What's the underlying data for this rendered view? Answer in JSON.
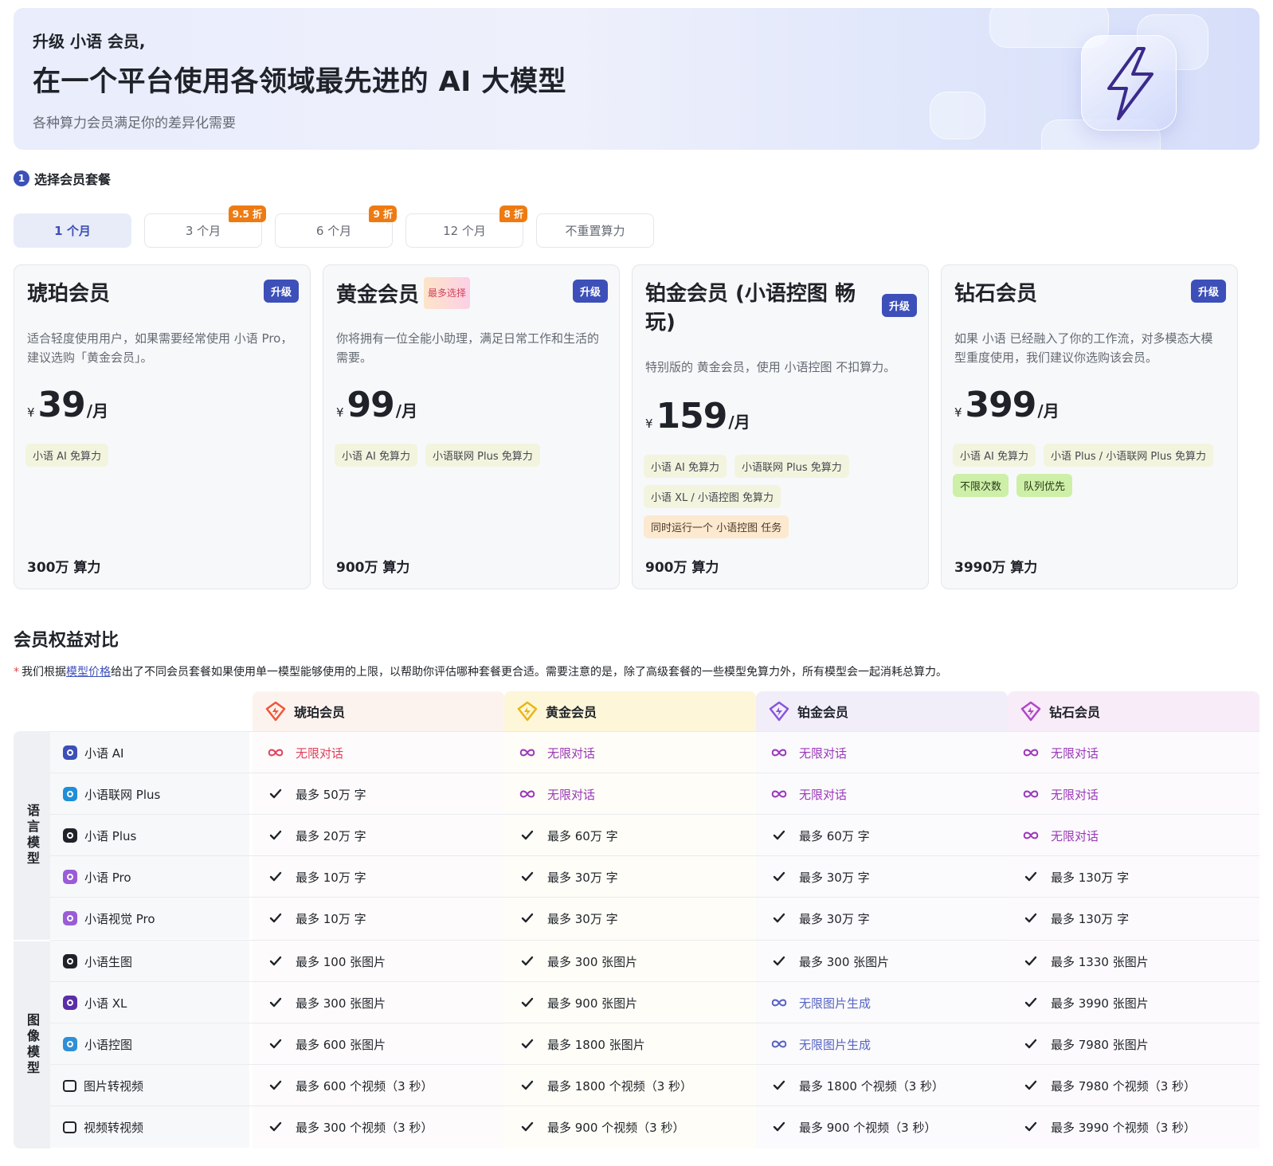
{
  "banner": {
    "small_title": "升级 小语 会员,",
    "big_title": "在一个平台使用各领域最先进的 AI 大模型",
    "subtitle": "各种算力会员满足你的差异化需要"
  },
  "step": {
    "number": "1",
    "label": "选择会员套餐"
  },
  "periods": [
    {
      "label": "1 个月",
      "discount": "",
      "active": true
    },
    {
      "label": "3 个月",
      "discount": "9.5 折"
    },
    {
      "label": "6 个月",
      "discount": "9 折"
    },
    {
      "label": "12 个月",
      "discount": "8 折"
    },
    {
      "label": "不重置算力",
      "discount": ""
    }
  ],
  "plans": [
    {
      "name": "琥珀会员",
      "upgrade": "升级",
      "desc": "适合轻度使用用户，如果需要经常使用 小语 Pro，建议选购「黄金会员」。",
      "currency": "¥",
      "price": "39",
      "unit": "/月",
      "tags": [
        {
          "text": "小语 AI 免算力"
        }
      ],
      "quota": "300万 算力"
    },
    {
      "name": "黄金会员",
      "badge": "最多选择",
      "upgrade": "升级",
      "desc": "你将拥有一位全能小助理，满足日常工作和生活的需要。",
      "currency": "¥",
      "price": "99",
      "unit": "/月",
      "tags": [
        {
          "text": "小语 AI 免算力"
        },
        {
          "text": "小语联网 Plus 免算力"
        }
      ],
      "quota": "900万 算力"
    },
    {
      "name": "铂金会员 (小语控图 畅玩)",
      "upgrade": "升级",
      "desc": "特别版的 黄金会员，使用 小语控图 不扣算力。",
      "currency": "¥",
      "price": "159",
      "unit": "/月",
      "tags": [
        {
          "text": "小语 AI 免算力"
        },
        {
          "text": "小语联网 Plus 免算力"
        },
        {
          "text": "小语 XL / 小语控图 免算力"
        },
        {
          "text": "同时运行一个 小语控图 任务"
        }
      ],
      "quota": "900万 算力"
    },
    {
      "name": "钻石会员",
      "upgrade": "升级",
      "desc": "如果 小语 已经融入了你的工作流，对多模态大模型重度使用，我们建议你选购该会员。",
      "currency": "¥",
      "price": "399",
      "unit": "/月",
      "tags": [
        {
          "text": "小语 AI 免算力"
        },
        {
          "text": "小语 Plus / 小语联网 Plus 免算力"
        },
        {
          "text": "不限次数"
        },
        {
          "text": "队列优先"
        }
      ],
      "quota": "3990万 算力"
    }
  ],
  "comparison": {
    "title": "会员权益对比",
    "note_star": "*",
    "note_before": "我们根据",
    "note_link": "模型价格",
    "note_after": "给出了不同会员套餐如果使用单一模型能够使用的上限，以帮助你评估哪种套餐更合适。需要注意的是，除了高级套餐的一些模型免算力外，所有模型会一起消耗总算力。",
    "headers": [
      "琥珀会员",
      "黄金会员",
      "铂金会员",
      "钻石会员"
    ],
    "categories": [
      "语言模型",
      "图像模型"
    ],
    "rows": [
      {
        "model": "小语 AI",
        "values": [
          "无限对话",
          "无限对话",
          "无限对话",
          "无限对话"
        ]
      },
      {
        "model": "小语联网 Plus",
        "values": [
          "最多 50万 字",
          "无限对话",
          "无限对话",
          "无限对话"
        ]
      },
      {
        "model": "小语 Plus",
        "values": [
          "最多 20万 字",
          "最多 60万 字",
          "最多 60万 字",
          "无限对话"
        ]
      },
      {
        "model": "小语 Pro",
        "values": [
          "最多 10万 字",
          "最多 30万 字",
          "最多 30万 字",
          "最多 130万 字"
        ]
      },
      {
        "model": "小语视觉 Pro",
        "values": [
          "最多 10万 字",
          "最多 30万 字",
          "最多 30万 字",
          "最多 130万 字"
        ]
      },
      {
        "model": "小语生图",
        "values": [
          "最多 100 张图片",
          "最多 300 张图片",
          "最多 300 张图片",
          "最多 1330 张图片"
        ]
      },
      {
        "model": "小语 XL",
        "values": [
          "最多 300 张图片",
          "最多 900 张图片",
          "无限图片生成",
          "最多 3990 张图片"
        ]
      },
      {
        "model": "小语控图",
        "values": [
          "最多 600 张图片",
          "最多 1800 张图片",
          "无限图片生成",
          "最多 7980 张图片"
        ]
      },
      {
        "model": "图片转视频",
        "values": [
          "最多 600 个视频（3 秒）",
          "最多 1800 个视频（3 秒）",
          "最多 1800 个视频（3 秒）",
          "最多 7980 个视频（3 秒）"
        ]
      },
      {
        "model": "视频转视频",
        "values": [
          "最多 300 个视频（3 秒）",
          "最多 900 个视频（3 秒）",
          "最多 900 个视频（3 秒）",
          "最多 3990 个视频（3 秒）"
        ]
      }
    ]
  },
  "colors": {
    "accent": "#3d4fb8",
    "discount": "#ee7b12",
    "amber_header": "#fdf3ee",
    "gold_header": "#fdf6d8",
    "platinum_header": "#f1eefa",
    "diamond_header": "#f8ecf8"
  }
}
